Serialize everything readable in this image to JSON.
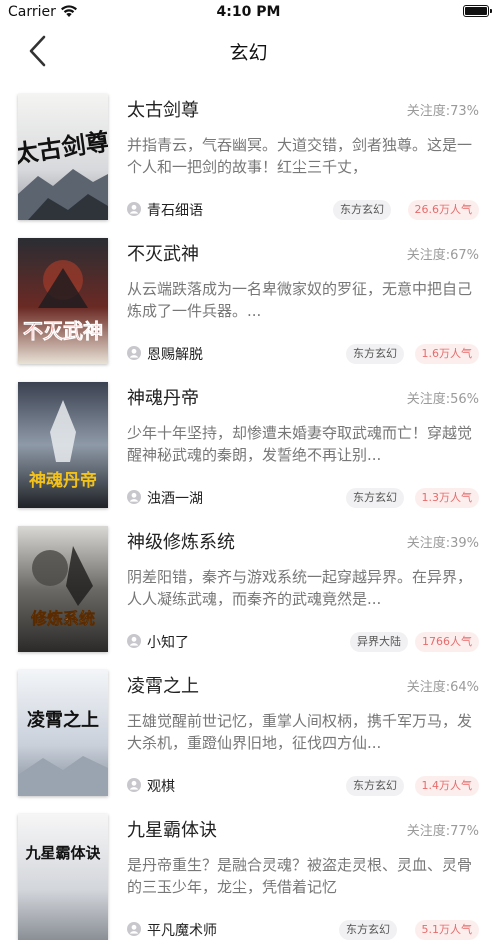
{
  "status": {
    "carrier": "Carrier",
    "time": "4:10 PM"
  },
  "nav": {
    "title": "玄幻"
  },
  "books": [
    {
      "title": "太古剑尊",
      "attention": "关注度:73%",
      "desc": "并指青云，气吞幽冥。大道交错，剑者独尊。这是一个人和一把剑的故事！红尘三千丈，",
      "author": "青石细语",
      "category": "东方玄幻",
      "popularity": "26.6万人气",
      "cover_text": "太古剑尊"
    },
    {
      "title": "不灭武神",
      "attention": "关注度:67%",
      "desc": "从云端跌落成为一名卑微家奴的罗征，无意中把自己炼成了一件兵器。...",
      "author": "恩赐解脱",
      "category": "东方玄幻",
      "popularity": "1.6万人气",
      "cover_text": "不灭武神"
    },
    {
      "title": "神魂丹帝",
      "attention": "关注度:56%",
      "desc": "少年十年坚持，却惨遭未婚妻夺取武魂而亡！穿越觉醒神秘武魂的秦朗，发誓绝不再让别...",
      "author": "浊酒一湖",
      "category": "东方玄幻",
      "popularity": "1.3万人气",
      "cover_text": "神魂丹帝"
    },
    {
      "title": "神级修炼系统",
      "attention": "关注度:39%",
      "desc": "阴差阳错，秦齐与游戏系统一起穿越异界。在异界，人人凝练武魂，而秦齐的武魂竟然是...",
      "author": "小知了",
      "category": "异界大陆",
      "popularity": "1766人气",
      "cover_text": "修炼系统"
    },
    {
      "title": "凌霄之上",
      "attention": "关注度:64%",
      "desc": "王雄觉醒前世记忆，重掌人间权柄，携千军万马，发大杀机，重蹬仙界旧地，征伐四方仙...",
      "author": "观棋",
      "category": "东方玄幻",
      "popularity": "1.4万人气",
      "cover_text": "凌霄之上"
    },
    {
      "title": "九星霸体诀",
      "attention": "关注度:77%",
      "desc": "是丹帝重生？是融合灵魂？被盗走灵根、灵血、灵骨的三玉少年，龙尘，凭借着记忆",
      "author": "平凡魔术师",
      "category": "东方玄幻",
      "popularity": "5.1万人气",
      "cover_text": "九星霸体诀"
    }
  ],
  "colors": {
    "accent_red": "#e86b6b",
    "tag_bg": "#f1f1f3"
  }
}
